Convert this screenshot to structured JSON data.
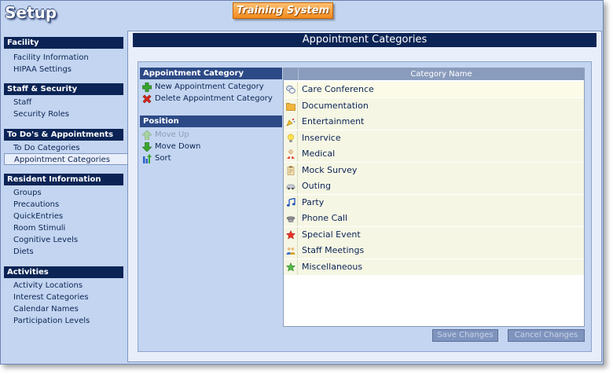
{
  "header": {
    "title": "Setup",
    "brand": "Training System"
  },
  "sidebar": [
    {
      "title": "Facility",
      "items": [
        "Facility Information",
        "HIPAA Settings"
      ]
    },
    {
      "title": "Staff & Security",
      "items": [
        "Staff",
        "Security Roles"
      ]
    },
    {
      "title": "To Do's & Appointments",
      "items": [
        "To Do Categories",
        "Appointment Categories"
      ],
      "active": "Appointment Categories"
    },
    {
      "title": "Resident Information",
      "items": [
        "Groups",
        "Precautions",
        "QuickEntries",
        "Room Stimuli",
        "Cognitive Levels",
        "Diets"
      ]
    },
    {
      "title": "Activities",
      "items": [
        "Activity Locations",
        "Interest Categories",
        "Calendar Names",
        "Participation Levels"
      ]
    }
  ],
  "main": {
    "title": "Appointment Categories",
    "appointment_section": {
      "title": "Appointment Category",
      "new_label": "New Appointment Category",
      "delete_label": "Delete Appointment Category"
    },
    "position_section": {
      "title": "Position",
      "move_up_label": "Move Up",
      "move_down_label": "Move Down",
      "sort_label": "Sort"
    },
    "table": {
      "column_header": "Category Name",
      "rows": [
        {
          "name": "Care Conference",
          "icon": "chat-bubbles-icon",
          "selected": true
        },
        {
          "name": "Documentation",
          "icon": "folder-icon"
        },
        {
          "name": "Entertainment",
          "icon": "party-horn-icon"
        },
        {
          "name": "Inservice",
          "icon": "lightbulb-icon"
        },
        {
          "name": "Medical",
          "icon": "doctor-icon"
        },
        {
          "name": "Mock Survey",
          "icon": "clipboard-icon"
        },
        {
          "name": "Outing",
          "icon": "car-icon"
        },
        {
          "name": "Party",
          "icon": "music-note-icon"
        },
        {
          "name": "Phone Call",
          "icon": "phone-icon"
        },
        {
          "name": "Special Event",
          "icon": "star-icon"
        },
        {
          "name": "Staff Meetings",
          "icon": "people-icon"
        },
        {
          "name": "Miscellaneous",
          "icon": "green-star-icon"
        }
      ]
    },
    "buttons": {
      "save_label": "Save Changes",
      "cancel_label": "Cancel Changes"
    }
  },
  "colors": {
    "nav_header": "#0b2455",
    "panel": "#c3d5f0",
    "row_bg": "#f6f6e4",
    "selection": "#e6e033",
    "brand": "#f28a1e"
  }
}
